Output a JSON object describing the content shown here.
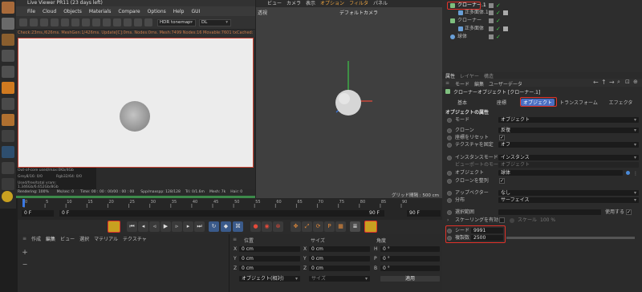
{
  "liveviewer": {
    "title": "Live Viewer PR11 (23 days left)",
    "menu": [
      "File",
      "Cloud",
      "Objects",
      "Materials",
      "Compare",
      "Options",
      "Help",
      "GUI"
    ],
    "tonemap": "HDR tonemap",
    "dl": "DL",
    "status": "Check:23ms./626ms. MeshGen:1/426ms. Update[C]:0ms. Nodes:0ms. Mesh:7499 Nodes:16 Movable:7601 txCached:",
    "stats": {
      "outofcore": "Out-of-core used/max:0Kb/4Gb",
      "grey": "Grey8/16: 0/0",
      "rgb": "Rgb32/64: 0/0",
      "vram": "Used/free/total vram: 1.346Gb/6.652Gb/8Gb"
    },
    "progress": {
      "rendering": "Rendering: 100%",
      "mssec": "Ms/sec: 0",
      "time": "Time: 00 : 00 : 00/00 : 00 : 00",
      "spp": "Spp/maxspp: 128/128",
      "tri": "Tri: 0/1.6m",
      "mesh": "Mesh: 7k",
      "hair": "Hair: 0"
    }
  },
  "viewport": {
    "menu": [
      "ビュー",
      "カメラ",
      "表示",
      "オプション",
      "フィルタ",
      "パネル"
    ],
    "active_menu": "オプション",
    "persp": "透視",
    "camera": "デフォルトカメラ",
    "grid": "グリッド間隔 : 500 cm"
  },
  "objects": {
    "rows": [
      {
        "label": "クローナー.1",
        "highlighted": true
      },
      {
        "label": "正多面体.1"
      },
      {
        "label": "クローナー"
      },
      {
        "label": "正多面体"
      },
      {
        "label": "球体"
      }
    ]
  },
  "attributes": {
    "tabs": [
      "属性",
      "レイヤー",
      "構造"
    ],
    "menu": [
      "モード",
      "編集",
      "ユーザーデータ"
    ],
    "object_title": "クローナーオブジェクト [クローナー.1]",
    "subtabs": [
      "基本",
      "座標",
      "オブジェクト",
      "トランスフォーム",
      "エフェクタ"
    ],
    "active_subtab": "オブジェクト",
    "section": "オブジェクトの属性",
    "fields": {
      "mode_label": "モード",
      "mode_value": "オブジェクト",
      "clone_label": "クローン",
      "clone_value": "反復",
      "reset_label": "座標をリセット",
      "texture_label": "テクスチャを固定",
      "texture_value": "オフ",
      "instance_label": "インスタンスモード",
      "instance_value": "インスタンス",
      "viewport_mode_label": "ビューポートのモード",
      "viewport_mode_value": "オブジェクト",
      "object_label": "オブジェクト",
      "object_value": "球体",
      "clone_arrange_label": "クローンを整列",
      "upvector_label": "アップベクター",
      "upvector_value": "なし",
      "distribution_label": "分布",
      "distribution_value": "サーフェイス",
      "selection_label": "選択範囲",
      "use_label": "使用する",
      "scaling_label": "スケーリングを有効",
      "scale_label": "スケール",
      "scale_value": "100 %",
      "seed_label": "シード",
      "seed_value": "9991",
      "count_label": "複製数",
      "count_value": "2500"
    }
  },
  "timeline": {
    "ticks": [
      "0",
      "5",
      "10",
      "15",
      "20",
      "25",
      "30",
      "35",
      "40",
      "45",
      "50",
      "55",
      "60",
      "65",
      "70",
      "75",
      "80",
      "85",
      "90"
    ],
    "start": "0 F",
    "current": "0 F",
    "end": "90 F",
    "end2": "90 F",
    "frame": "0 F"
  },
  "materials": {
    "menu": [
      "作成",
      "編集",
      "ビュー",
      "選択",
      "マテリアル",
      "テクスチャ"
    ]
  },
  "coordinates": {
    "headers": [
      "位置",
      "サイズ",
      "角度"
    ],
    "rows": [
      {
        "axis": "X",
        "pos": "0 cm",
        "size_axis": "X",
        "size": "0 cm",
        "rot_axis": "H",
        "rot": "0 °"
      },
      {
        "axis": "Y",
        "pos": "0 cm",
        "size_axis": "Y",
        "size": "0 cm",
        "rot_axis": "P",
        "rot": "0 °"
      },
      {
        "axis": "Z",
        "pos": "0 cm",
        "size_axis": "Z",
        "size": "0 cm",
        "rot_axis": "B",
        "rot": "0 °"
      }
    ],
    "mode": "オブジェクト(相対)",
    "size_mode": "サイズ",
    "apply": "適用"
  },
  "colors": {
    "accent_orange": "#f0a640",
    "highlight_red": "#e2322a",
    "active_tab": "#4a6fc4"
  }
}
